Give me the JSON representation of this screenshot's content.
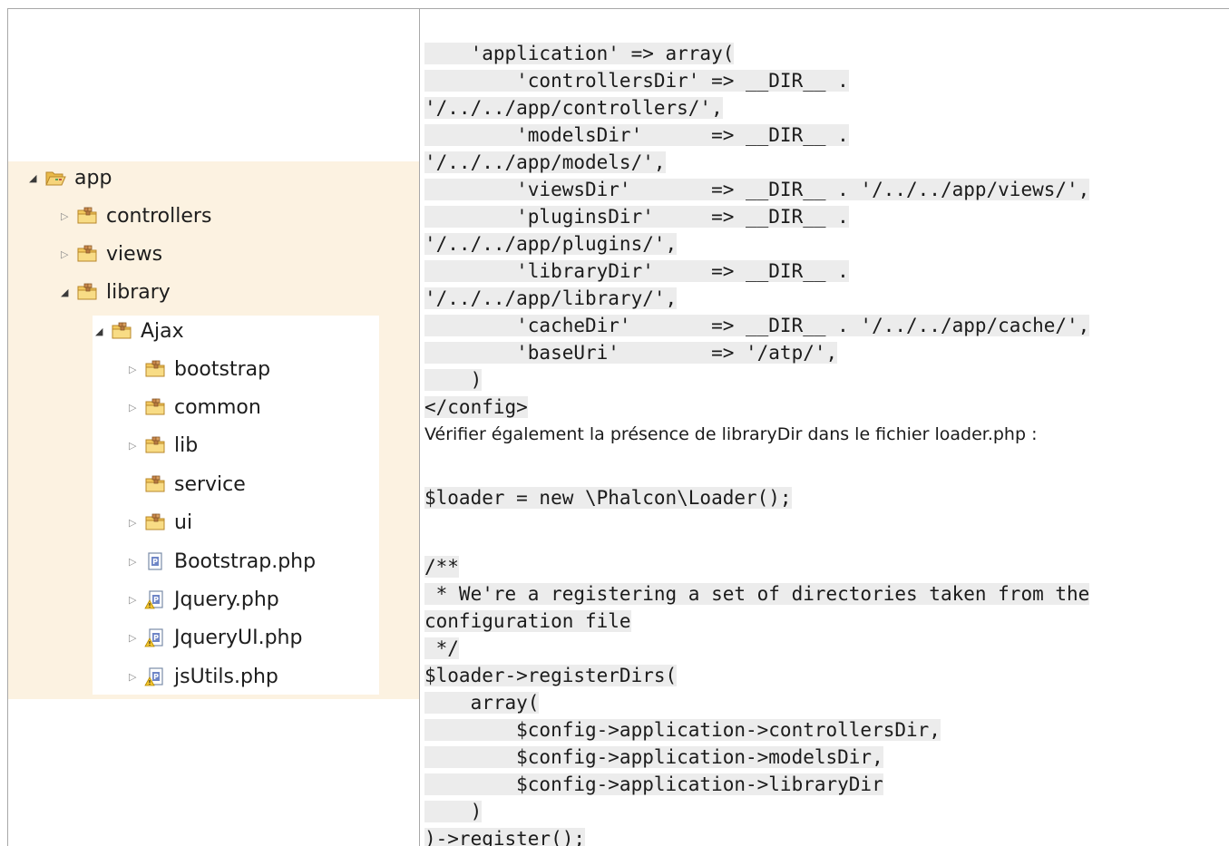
{
  "tree": {
    "items": [
      {
        "label": "app",
        "twisty": "expanded",
        "icon": "open-folder-icon"
      },
      {
        "label": "controllers",
        "twisty": "collapsed",
        "icon": "package-folder-icon"
      },
      {
        "label": "views",
        "twisty": "collapsed",
        "icon": "package-folder-icon"
      },
      {
        "label": "library",
        "twisty": "expanded",
        "icon": "package-folder-icon"
      },
      {
        "label": "Ajax",
        "twisty": "expanded",
        "icon": "package-folder-icon"
      },
      {
        "label": "bootstrap",
        "twisty": "collapsed",
        "icon": "package-folder-icon"
      },
      {
        "label": "common",
        "twisty": "collapsed",
        "icon": "package-folder-icon"
      },
      {
        "label": "lib",
        "twisty": "collapsed",
        "icon": "package-folder-icon"
      },
      {
        "label": "service",
        "twisty": "none",
        "icon": "package-folder-icon"
      },
      {
        "label": "ui",
        "twisty": "collapsed",
        "icon": "package-folder-icon"
      },
      {
        "label": "Bootstrap.php",
        "twisty": "collapsed",
        "icon": "php-file-icon"
      },
      {
        "label": "Jquery.php",
        "twisty": "collapsed",
        "icon": "php-file-warning-icon"
      },
      {
        "label": "JqueryUI.php",
        "twisty": "collapsed",
        "icon": "php-file-warning-icon"
      },
      {
        "label": "jsUtils.php",
        "twisty": "collapsed",
        "icon": "php-file-warning-icon"
      }
    ]
  },
  "content": {
    "lines": [
      {
        "text": "    'application' => array(",
        "kind": "code"
      },
      {
        "text": "        'controllersDir' => __DIR__ .",
        "kind": "code"
      },
      {
        "text": "'/../../app/controllers/',",
        "kind": "code"
      },
      {
        "text": "        'modelsDir'      => __DIR__ .",
        "kind": "code"
      },
      {
        "text": "'/../../app/models/',",
        "kind": "code"
      },
      {
        "text": "        'viewsDir'       => __DIR__ . '/../../app/views/',",
        "kind": "code"
      },
      {
        "text": "        'pluginsDir'     => __DIR__ .",
        "kind": "code"
      },
      {
        "text": "'/../../app/plugins/',",
        "kind": "code"
      },
      {
        "text": "        'libraryDir'     => __DIR__ .",
        "kind": "code"
      },
      {
        "text": "'/../../app/library/',",
        "kind": "code"
      },
      {
        "text": "        'cacheDir'       => __DIR__ . '/../../app/cache/',",
        "kind": "code"
      },
      {
        "text": "        'baseUri'        => '/atp/',",
        "kind": "code"
      },
      {
        "text": "    )",
        "kind": "code"
      },
      {
        "text": "</config>",
        "kind": "code"
      },
      {
        "text": "Vérifier également la présence de libraryDir dans le fichier loader.php :",
        "kind": "prose"
      },
      {
        "text": "",
        "kind": "blank"
      },
      {
        "text": "$loader = new \\Phalcon\\Loader();",
        "kind": "code"
      },
      {
        "text": "",
        "kind": "blank"
      },
      {
        "text": "/**",
        "kind": "code"
      },
      {
        "text": " * We're a registering a set of directories taken from the",
        "kind": "code"
      },
      {
        "text": "configuration file",
        "kind": "code"
      },
      {
        "text": " */",
        "kind": "code"
      },
      {
        "text": "$loader->registerDirs(",
        "kind": "code"
      },
      {
        "text": "    array(",
        "kind": "code"
      },
      {
        "text": "        $config->application->controllersDir,",
        "kind": "code"
      },
      {
        "text": "        $config->application->modelsDir,",
        "kind": "code"
      },
      {
        "text": "        $config->application->libraryDir",
        "kind": "code"
      },
      {
        "text": "    )",
        "kind": "code"
      },
      {
        "text": ")->register();",
        "kind": "code"
      }
    ]
  }
}
